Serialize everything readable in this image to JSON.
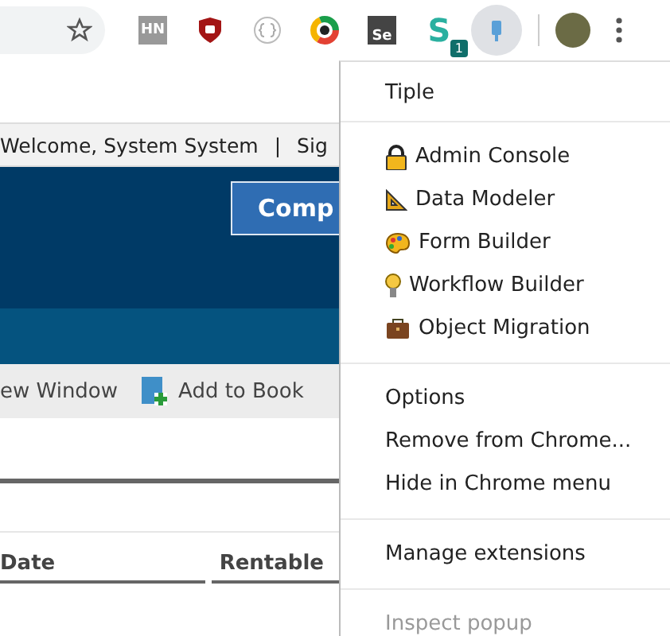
{
  "toolbar": {
    "extensions": [
      {
        "kind": "tile",
        "label": "HN",
        "selected": false
      },
      {
        "kind": "shield",
        "selected": false
      },
      {
        "kind": "braces",
        "selected": false
      },
      {
        "kind": "ring",
        "selected": false
      },
      {
        "kind": "tile",
        "label": "Se",
        "selected": false
      },
      {
        "kind": "letter",
        "label": "S",
        "badge": "1",
        "selected": false
      },
      {
        "kind": "pin",
        "selected": true
      }
    ]
  },
  "page": {
    "welcome": "Welcome, System System",
    "separator": "|",
    "sign": "Sig",
    "button": "Comp",
    "actions": [
      "ew Window",
      "Add to Book"
    ],
    "columns": [
      "Date",
      "Rentable"
    ]
  },
  "menu": {
    "title": "Tiple",
    "groups": [
      [
        {
          "kind": "app",
          "label": "Admin Console",
          "disabled": false
        },
        {
          "kind": "app",
          "label": "Data Modeler",
          "disabled": false
        },
        {
          "kind": "app",
          "label": "Form Builder",
          "disabled": false
        },
        {
          "kind": "app",
          "label": "Workflow Builder",
          "disabled": false
        },
        {
          "kind": "app",
          "label": "Object Migration",
          "disabled": false
        }
      ],
      [
        {
          "kind": "plain",
          "label": "Options",
          "disabled": false
        },
        {
          "kind": "plain",
          "label": "Remove from Chrome...",
          "disabled": false
        },
        {
          "kind": "plain",
          "label": "Hide in Chrome menu",
          "disabled": false
        }
      ],
      [
        {
          "kind": "plain",
          "label": "Manage extensions",
          "disabled": false
        }
      ],
      [
        {
          "kind": "plain",
          "label": "Inspect popup",
          "disabled": true
        }
      ]
    ]
  }
}
